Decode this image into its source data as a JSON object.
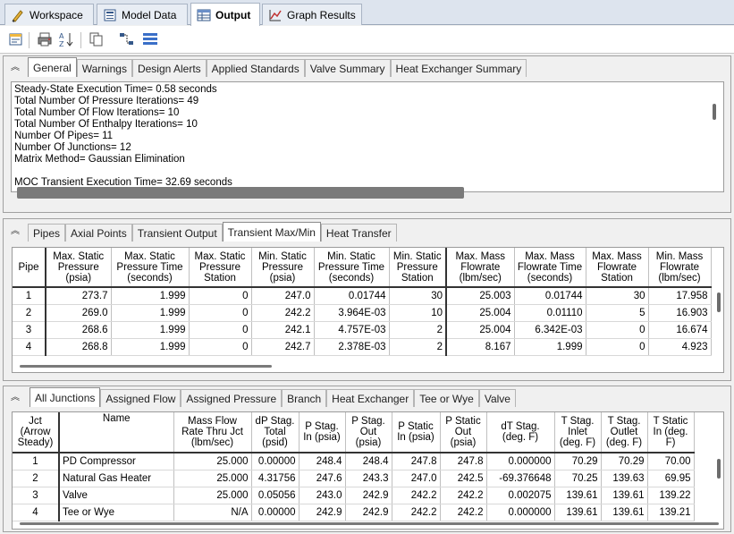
{
  "window_tabs": [
    {
      "label": "Workspace",
      "icon": "workspace-icon"
    },
    {
      "label": "Model Data",
      "icon": "model-data-icon"
    },
    {
      "label": "Output",
      "icon": "output-icon"
    },
    {
      "label": "Graph Results",
      "icon": "graph-icon"
    }
  ],
  "toolbar": {
    "icons": [
      "output-control-icon",
      "print-icon",
      "sort-icon",
      "copy-icon",
      "transfer-results-icon",
      "list-icon"
    ]
  },
  "general_panel": {
    "tabs": [
      "General",
      "Warnings",
      "Design Alerts",
      "Applied Standards",
      "Valve Summary",
      "Heat Exchanger Summary"
    ],
    "lines": [
      "Steady-State Execution Time= 0.58 seconds",
      "Total Number Of Pressure Iterations= 49",
      "Total Number Of Flow Iterations= 10",
      "Total Number Of Enthalpy Iterations= 10",
      "Number Of Pipes= 11",
      "Number Of Junctions= 12",
      "Matrix Method= Gaussian Elimination",
      "",
      "MOC Transient Execution Time= 32.69 seconds"
    ]
  },
  "pipe_panel": {
    "tabs": [
      "Pipes",
      "Axial Points",
      "Transient Output",
      "Transient Max/Min",
      "Heat Transfer"
    ],
    "headers": [
      "Pipe",
      "Max. Static Pressure (psia)",
      "Max. Static Pressure Time (seconds)",
      "Max. Static Pressure Station",
      "Min. Static Pressure (psia)",
      "Min. Static Pressure Time (seconds)",
      "Min. Static Pressure Station",
      "Max. Mass Flowrate (lbm/sec)",
      "Max. Mass Flowrate Time (seconds)",
      "Max. Mass Flowrate Station",
      "Min. Mass Flowrate (lbm/sec)"
    ],
    "rows": [
      [
        "1",
        "273.7",
        "1.999",
        "0",
        "247.0",
        "0.01744",
        "30",
        "25.003",
        "0.01744",
        "30",
        "17.958"
      ],
      [
        "2",
        "269.0",
        "1.999",
        "0",
        "242.2",
        "3.964E-03",
        "10",
        "25.004",
        "0.01110",
        "5",
        "16.903"
      ],
      [
        "3",
        "268.6",
        "1.999",
        "0",
        "242.1",
        "4.757E-03",
        "2",
        "25.004",
        "6.342E-03",
        "0",
        "16.674"
      ],
      [
        "4",
        "268.8",
        "1.999",
        "0",
        "242.7",
        "2.378E-03",
        "2",
        "8.167",
        "1.999",
        "0",
        "4.923"
      ]
    ]
  },
  "junction_panel": {
    "tabs": [
      "All Junctions",
      "Assigned Flow",
      "Assigned Pressure",
      "Branch",
      "Heat Exchanger",
      "Tee or Wye",
      "Valve"
    ],
    "headers": [
      "Jct (Arrow Steady)",
      "Name",
      "Mass Flow Rate Thru Jct (lbm/sec)",
      "dP Stag. Total (psid)",
      "P Stag. In (psia)",
      "P Stag. Out (psia)",
      "P Static In (psia)",
      "P Static Out (psia)",
      "dT Stag. (deg. F)",
      "T Stag. Inlet (deg. F)",
      "T Stag. Outlet (deg. F)",
      "T Static In (deg. F)"
    ],
    "rows": [
      [
        "1",
        "PD Compressor",
        "25.000",
        "0.00000",
        "248.4",
        "248.4",
        "247.8",
        "247.8",
        "0.000000",
        "70.29",
        "70.29",
        "70.00"
      ],
      [
        "2",
        "Natural Gas Heater",
        "25.000",
        "4.31756",
        "247.6",
        "243.3",
        "247.0",
        "242.5",
        "-69.376648",
        "70.25",
        "139.63",
        "69.95"
      ],
      [
        "3",
        "Valve",
        "25.000",
        "0.05056",
        "243.0",
        "242.9",
        "242.2",
        "242.2",
        "0.002075",
        "139.61",
        "139.61",
        "139.22"
      ],
      [
        "4",
        "Tee or Wye",
        "N/A",
        "0.00000",
        "242.9",
        "242.9",
        "242.2",
        "242.2",
        "0.000000",
        "139.61",
        "139.61",
        "139.21"
      ]
    ]
  }
}
